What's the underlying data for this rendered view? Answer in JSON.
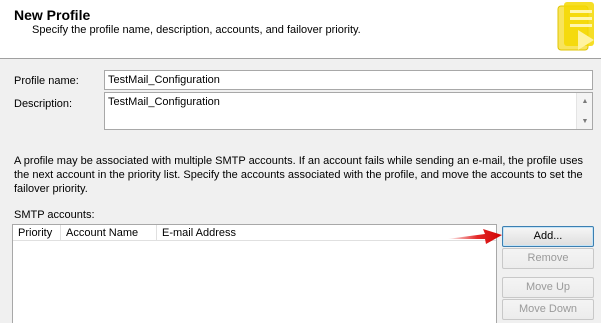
{
  "header": {
    "title": "New Profile",
    "subtitle": "Specify the profile name, description, accounts, and failover priority."
  },
  "form": {
    "profile_name_label": "Profile name:",
    "profile_name_value": "TestMail_Configuration",
    "description_label": "Description:",
    "description_value": "TestMail_Configuration"
  },
  "info": {
    "text": "A profile may be associated with multiple SMTP accounts. If an account fails while sending an e-mail, the profile uses the next account in the priority list. Specify the accounts associated with the profile, and move the accounts to set the failover priority."
  },
  "smtp": {
    "label": "SMTP accounts:",
    "columns": [
      "Priority",
      "Account Name",
      "E-mail Address"
    ],
    "rows": []
  },
  "buttons": {
    "add": "Add...",
    "remove": "Remove",
    "move_up": "Move Up",
    "move_down": "Move Down"
  },
  "colors": {
    "annotation_arrow": "#e01010",
    "logo_yellow": "#f5d800"
  },
  "icons": {
    "logo": "mail-profile-logo-icon",
    "scroll_up": "scroll-up-arrow-icon",
    "scroll_down": "scroll-down-arrow-icon",
    "annotation": "red-arrow-icon"
  }
}
